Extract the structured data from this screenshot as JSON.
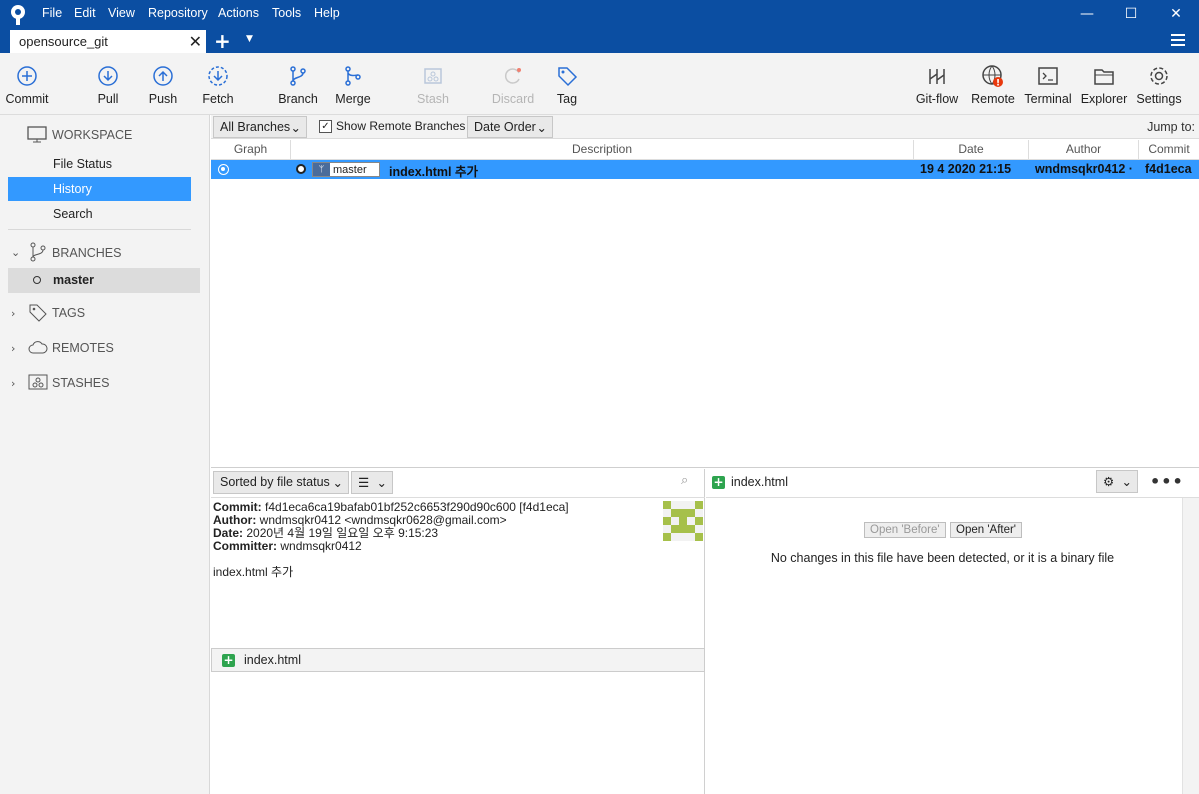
{
  "menu": [
    "File",
    "Edit",
    "View",
    "Repository",
    "Actions",
    "Tools",
    "Help"
  ],
  "tab": {
    "label": "opensource_git"
  },
  "toolbar": {
    "commit": "Commit",
    "pull": "Pull",
    "push": "Push",
    "fetch": "Fetch",
    "branch": "Branch",
    "merge": "Merge",
    "stash": "Stash",
    "discard": "Discard",
    "tag": "Tag",
    "gitflow": "Git-flow",
    "remote": "Remote",
    "terminal": "Terminal",
    "explorer": "Explorer",
    "settings": "Settings"
  },
  "sidebar": {
    "workspace": "WORKSPACE",
    "file_status": "File Status",
    "history": "History",
    "search": "Search",
    "branches": "BRANCHES",
    "master": "master",
    "tags": "TAGS",
    "remotes": "REMOTES",
    "stashes": "STASHES"
  },
  "filter": {
    "branches": "All Branches",
    "show_remote": "Show Remote Branches",
    "order": "Date Order",
    "jump": "Jump to:"
  },
  "columns": {
    "graph": "Graph",
    "description": "Description",
    "date": "Date",
    "author": "Author",
    "commit": "Commit"
  },
  "commit_row": {
    "branch_tag": "master",
    "message": "index.html 추가",
    "date": "19 4 2020 21:15",
    "author": "wndmsqkr0412 ·",
    "hash": "f4d1eca"
  },
  "details": {
    "sort": "Sorted by file status",
    "commit_label": "Commit:",
    "commit_value": "f4d1eca6ca19bafab01bf252c6653f290d90c600 [f4d1eca]",
    "author_label": "Author:",
    "author_value": "wndmsqkr0412 <wndmsqkr0628@gmail.com>",
    "date_label": "Date:",
    "date_value": "2020년 4월 19일 일요일 오후 9:15:23",
    "committer_label": "Committer:",
    "committer_value": "wndmsqkr0412",
    "message": "index.html 추가",
    "file": "index.html"
  },
  "diff": {
    "file": "index.html",
    "open_before": "Open 'Before'",
    "open_after": "Open 'After'",
    "notice": "No changes in this file have been detected, or it is a binary file"
  },
  "colors": {
    "titlebar": "#0b4ea2",
    "selection": "#3399ff",
    "added": "#2ea44f"
  }
}
